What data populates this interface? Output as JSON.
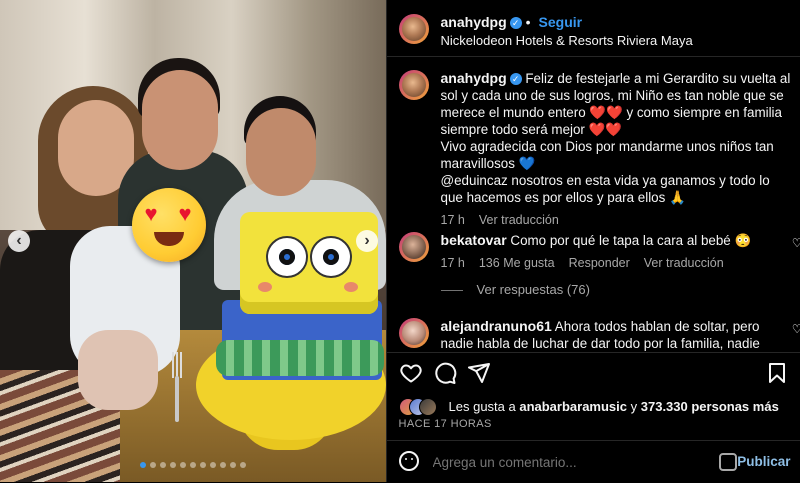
{
  "post_header": {
    "username": "anahydpg",
    "follow_label": "Seguir",
    "separator": "•",
    "location": "Nickelodeon Hotels & Resorts Riviera Maya"
  },
  "caption": {
    "username": "anahydpg",
    "text": "Feliz de festejarle a mi Gerardito su vuelta al sol y cada uno de sus logros, mi Niño es tan noble que se merece el mundo entero ❤️❤️ y como siempre en familia siempre todo será mejor ❤️❤️",
    "text2": "Vivo agradecida con Dios por mandarme unos niños tan maravillosos 💙",
    "text3": "@eduincaz nosotros en esta vida ya ganamos y todo lo que hacemos es por ellos y para ellos 🙏",
    "time": "17 h",
    "see_translation": "Ver traducción"
  },
  "comments": [
    {
      "username": "bekatovar",
      "text": "Como por qué le tapa la cara al bebé 😳",
      "time": "17 h",
      "likes": "136 Me gusta",
      "reply_label": "Responder",
      "see_translation": "Ver traducción",
      "view_replies": "Ver respuestas (76)"
    },
    {
      "username": "alejandranuno61",
      "text": "Ahora todos hablan de soltar, pero nadie habla de luchar de dar todo por la familia, nadie"
    }
  ],
  "likes": {
    "prefix": "Les gusta a ",
    "user": "anabarbaramusic",
    "middle": " y ",
    "count": "373.330",
    "suffix": " personas más"
  },
  "timestamp": "HACE 17 HORAS",
  "add_comment": {
    "placeholder": "Agrega un comentario...",
    "post_label": "Publicar"
  },
  "icons": {
    "like": "heart-icon",
    "comment": "comment-icon",
    "share": "share-icon",
    "save": "bookmark-icon",
    "emoji": "emoji-icon",
    "gif": "gif-icon"
  },
  "carousel": {
    "total_dots": 11,
    "active_index": 0
  },
  "colors": {
    "background": "#000000",
    "accent": "#3897f0",
    "muted": "#a8a8a8"
  }
}
